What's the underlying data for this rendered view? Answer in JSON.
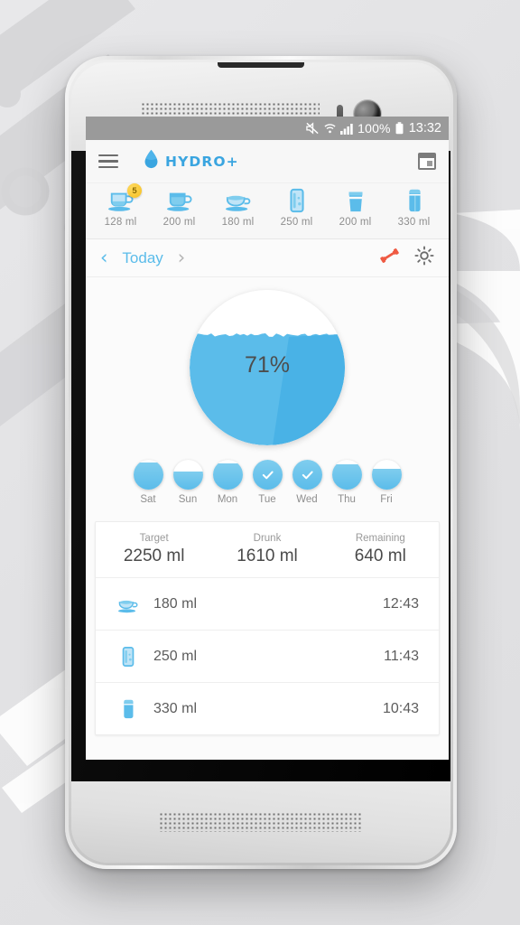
{
  "statusbar": {
    "icons": [
      "mute-icon",
      "wifi-icon",
      "signal-icon"
    ],
    "battery_percent": "100%",
    "time": "13:32"
  },
  "appbar": {
    "menu_icon": "hamburger-menu-icon",
    "logo_icon": "water-drop-icon",
    "brand": "HYDRO+",
    "calendar_icon": "calendar-icon"
  },
  "drinks": [
    {
      "icon": "teacup-icon",
      "amount": "128 ml",
      "badge": "5"
    },
    {
      "icon": "mug-icon",
      "amount": "200 ml",
      "badge": ""
    },
    {
      "icon": "saucer-cup-icon",
      "amount": "180 ml",
      "badge": ""
    },
    {
      "icon": "tall-glass-icon",
      "amount": "250 ml",
      "badge": ""
    },
    {
      "icon": "tumbler-icon",
      "amount": "200 ml",
      "badge": ""
    },
    {
      "icon": "can-icon",
      "amount": "330 ml",
      "badge": ""
    }
  ],
  "datenav": {
    "prev": "‹",
    "title": "Today",
    "next": "›",
    "dumbbell_icon": "dumbbell-icon",
    "weather_icon": "sun-weather-icon"
  },
  "gauge": {
    "percent_label": "71%",
    "percent_value": 71,
    "fill_color": "#5bbcea",
    "fill_color_dark": "#49b2e6",
    "background_color": "#ffffff"
  },
  "week": [
    {
      "day": "Sat",
      "fill": 90,
      "checked": false
    },
    {
      "day": "Sun",
      "fill": 62,
      "checked": false
    },
    {
      "day": "Mon",
      "fill": 88,
      "checked": false
    },
    {
      "day": "Tue",
      "fill": 100,
      "checked": true
    },
    {
      "day": "Wed",
      "fill": 100,
      "checked": true
    },
    {
      "day": "Thu",
      "fill": 85,
      "checked": false
    },
    {
      "day": "Fri",
      "fill": 71,
      "checked": false
    }
  ],
  "stats": [
    {
      "label": "Target",
      "value": "2250 ml"
    },
    {
      "label": "Drunk",
      "value": "1610 ml"
    },
    {
      "label": "Remaining",
      "value": "640 ml"
    }
  ],
  "log": [
    {
      "icon": "saucer-cup-icon",
      "amount": "180 ml",
      "time": "12:43"
    },
    {
      "icon": "tall-glass-icon",
      "amount": "250 ml",
      "time": "11:43"
    },
    {
      "icon": "can-icon",
      "amount": "330 ml",
      "time": "10:43"
    }
  ],
  "colors": {
    "accent": "#5bbcea",
    "brand": "#3aa5e0",
    "badge": "#f5bf1f",
    "dumbbell": "#ef5a43",
    "statusbar": "#9a9a9a"
  }
}
